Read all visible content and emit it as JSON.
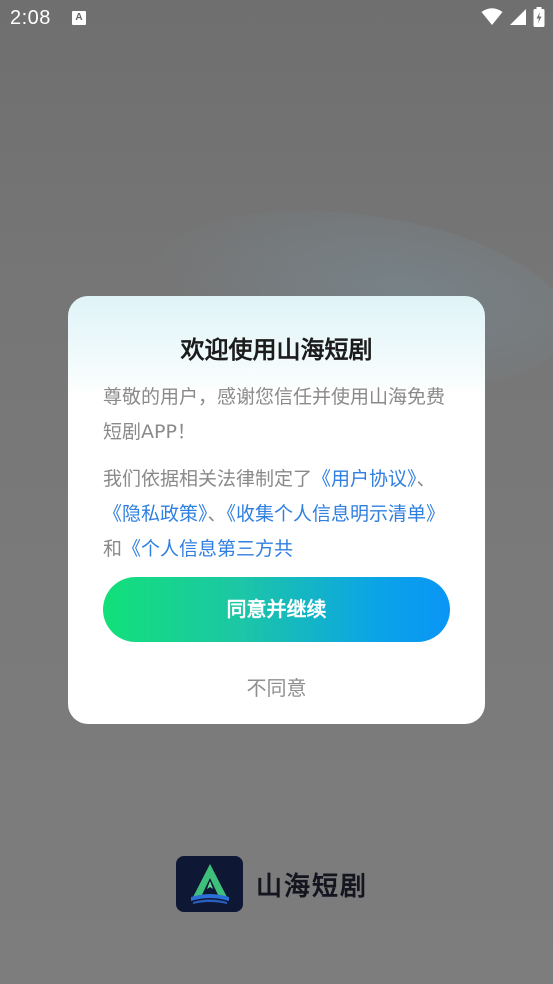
{
  "status_bar": {
    "time": "2:08",
    "notification_icon": "A"
  },
  "dialog": {
    "title": "欢迎使用山海短剧",
    "intro": "尊敬的用户，感谢您信任并使用山海免费短剧APP！",
    "policy_text_lead": "我们依据相关法律制定了",
    "link_user_agreement": "《用户协议》",
    "sep1": "、",
    "link_privacy_policy": "《隐私政策》",
    "sep2": "、",
    "link_personal_info_list": "《收集个人信息明示清单》",
    "conj": "和",
    "link_third_party": "《个人信息第三方共",
    "agree_button": "同意并继续",
    "disagree_button": "不同意"
  },
  "brand": {
    "name": "山海短剧"
  },
  "colors": {
    "link": "#2f7fe0",
    "button_gradient_start": "#12e07a",
    "button_gradient_end": "#0a95f5"
  }
}
